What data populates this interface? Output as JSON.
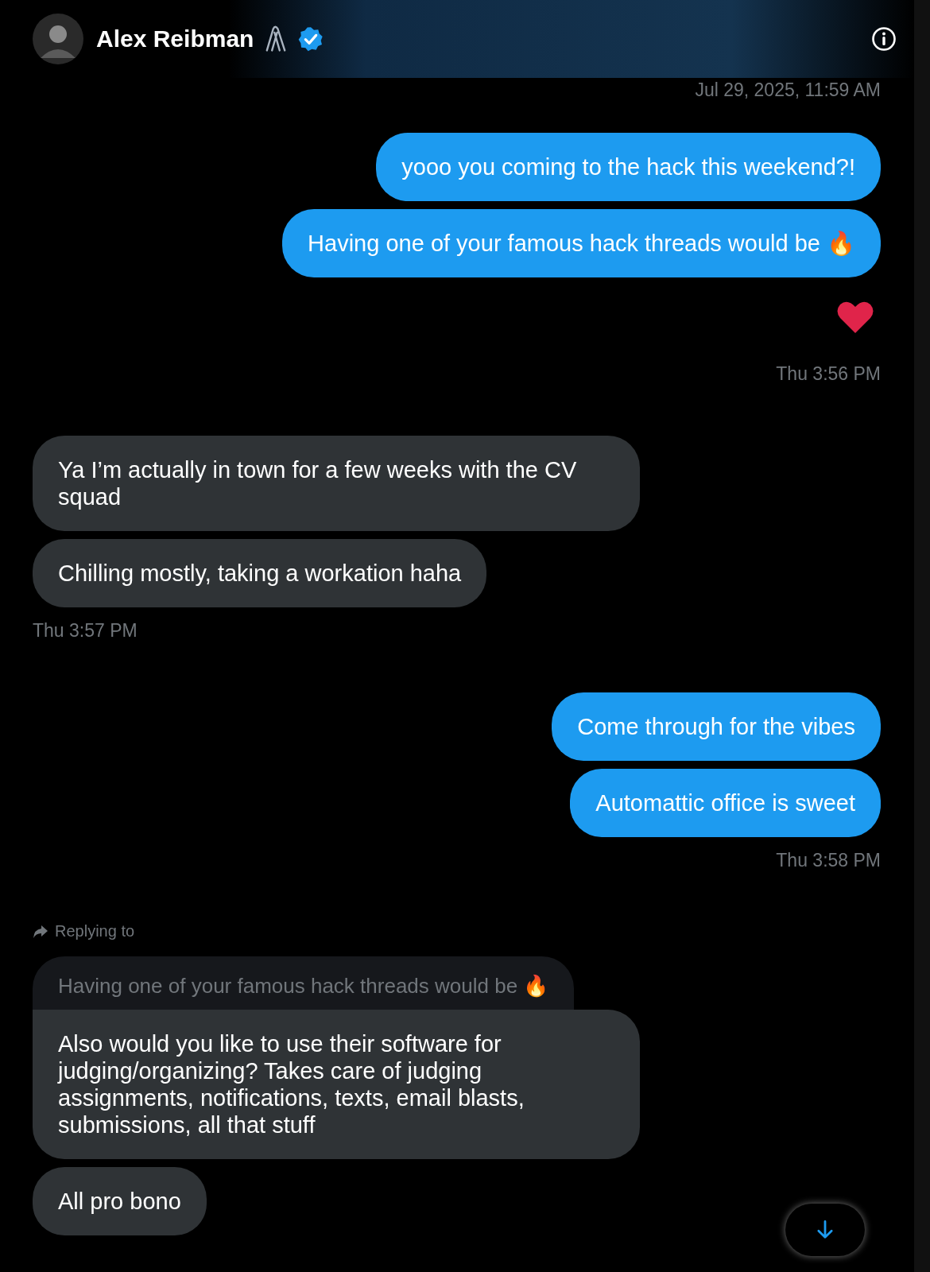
{
  "header": {
    "name": "Alex Reibman"
  },
  "messages": [
    {
      "kind": "timestamp",
      "sent": true,
      "text": "Jul 29, 2025, 11:59 AM"
    },
    {
      "kind": "message",
      "sent": true,
      "text": "yooo you coming to the hack this weekend?!"
    },
    {
      "kind": "message",
      "sent": true,
      "text": "Having one of your famous hack threads would be 🔥",
      "liked": true
    },
    {
      "kind": "timestamp",
      "sent": true,
      "text": "Thu 3:56 PM"
    },
    {
      "kind": "message",
      "sent": false,
      "text": "Ya I’m actually in town for a few weeks with the CV squad"
    },
    {
      "kind": "message",
      "sent": false,
      "text": "Chilling mostly, taking a workation haha"
    },
    {
      "kind": "timestamp",
      "sent": false,
      "text": "Thu 3:57 PM"
    },
    {
      "kind": "message",
      "sent": true,
      "text": "Come through for the vibes"
    },
    {
      "kind": "message",
      "sent": true,
      "text": "Automattic office is sweet"
    },
    {
      "kind": "timestamp",
      "sent": true,
      "text": "Thu 3:58 PM"
    },
    {
      "kind": "message",
      "sent": false,
      "replying_label": "Replying to",
      "quoted": "Having one of your famous hack threads would be 🔥",
      "text": "Also would you like to use their software for judging/organizing? Takes care of judging assignments, notifications, texts, email blasts, submissions, all that stuff"
    },
    {
      "kind": "message",
      "sent": false,
      "text": "All pro bono"
    }
  ]
}
